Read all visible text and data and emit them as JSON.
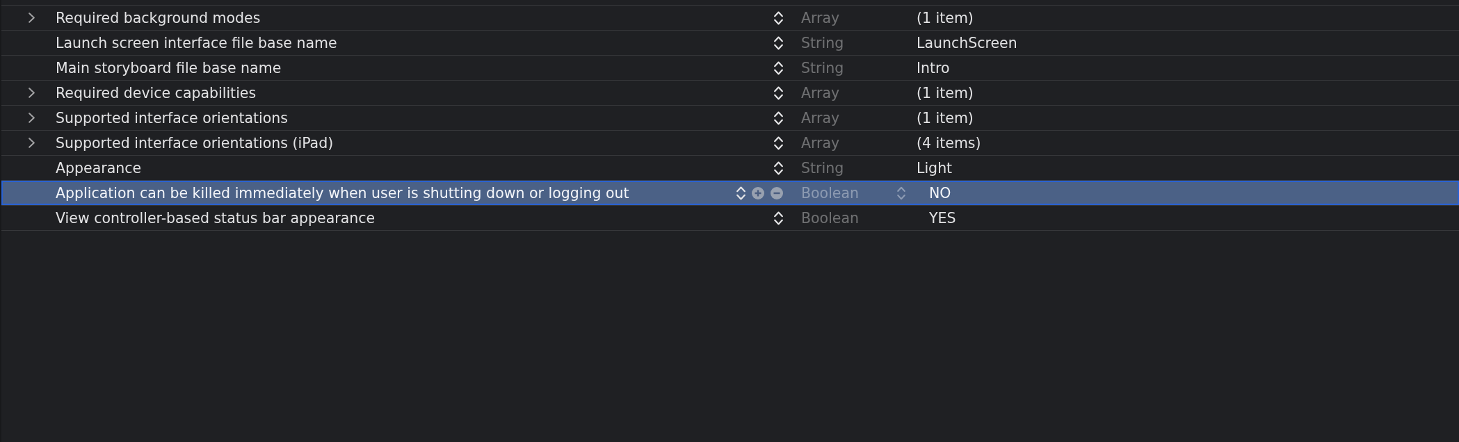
{
  "rows": [
    {
      "kind": "array",
      "expanded": false,
      "key": "Required background modes",
      "type": "Array",
      "value": "(1 item)",
      "selected": false
    },
    {
      "kind": "string",
      "key": "Launch screen interface file base name",
      "type": "String",
      "value": "LaunchScreen",
      "selected": false
    },
    {
      "kind": "string",
      "key": "Main storyboard file base name",
      "type": "String",
      "value": "Intro",
      "selected": false
    },
    {
      "kind": "array",
      "expanded": false,
      "key": "Required device capabilities",
      "type": "Array",
      "value": "(1 item)",
      "selected": false
    },
    {
      "kind": "array",
      "expanded": false,
      "key": "Supported interface orientations",
      "type": "Array",
      "value": "(1 item)",
      "selected": false
    },
    {
      "kind": "array",
      "expanded": false,
      "key": "Supported interface orientations (iPad)",
      "type": "Array",
      "value": "(4 items)",
      "selected": false
    },
    {
      "kind": "string",
      "key": "Appearance",
      "type": "String",
      "value": "Light",
      "selected": false
    },
    {
      "kind": "boolean",
      "key": "Application can be killed immediately when user is shutting down or logging out",
      "type": "Boolean",
      "value": "NO",
      "selected": true
    },
    {
      "kind": "boolean",
      "key": "View controller-based status bar appearance",
      "type": "Boolean",
      "value": "YES",
      "selected": false
    }
  ]
}
